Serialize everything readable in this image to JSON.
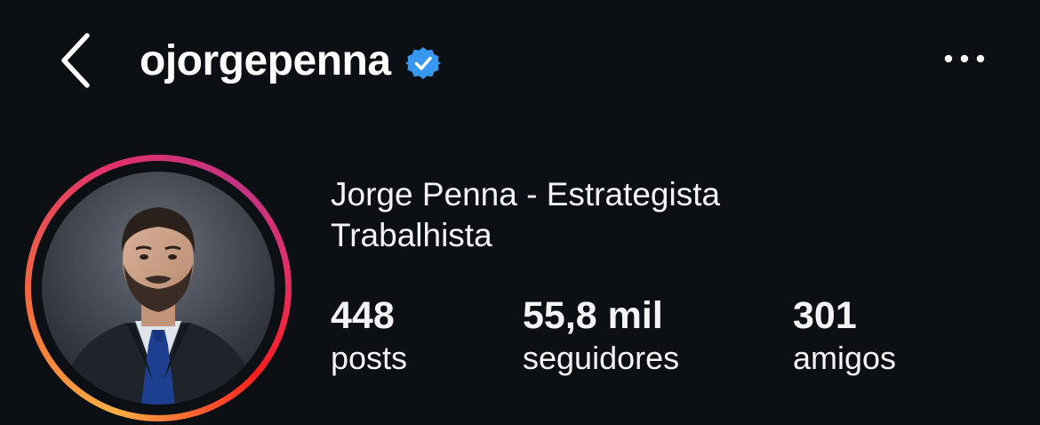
{
  "header": {
    "username": "ojorgepenna",
    "verified": true,
    "icons": {
      "back": "chevron-left-icon",
      "verified": "verified-badge-icon",
      "more": "more-horizontal-icon"
    }
  },
  "profile": {
    "display_name": "Jorge Penna - Estrategista Trabalhista",
    "stats": [
      {
        "value": "448",
        "label": "posts"
      },
      {
        "value": "55,8 mil",
        "label": "seguidores"
      },
      {
        "value": "301",
        "label": "amigos"
      }
    ]
  },
  "colors": {
    "background": "#0c0f14",
    "text": "#ffffff",
    "verified_blue": "#3897f0",
    "story_ring": [
      "#fcaf45",
      "#f77737",
      "#e1306c",
      "#c13584",
      "#fd1d1d"
    ]
  }
}
